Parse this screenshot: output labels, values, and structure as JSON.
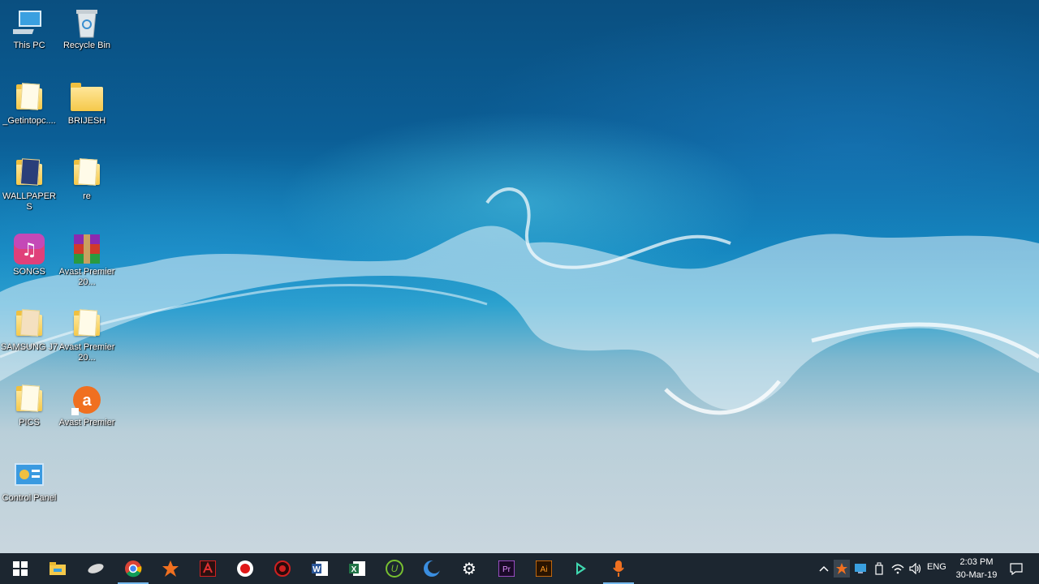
{
  "desktop": {
    "icons": [
      {
        "label": "This PC",
        "icon": "this-pc-icon"
      },
      {
        "label": "Recycle Bin",
        "icon": "recycle-bin-icon"
      },
      {
        "label": "_Getintopc....",
        "icon": "folder-icon"
      },
      {
        "label": "BRIJESH",
        "icon": "folder-icon"
      },
      {
        "label": "WALLPAPERS",
        "icon": "folder-icon"
      },
      {
        "label": "re",
        "icon": "folder-icon"
      },
      {
        "label": "SONGS",
        "icon": "music-icon"
      },
      {
        "label": "Avast Premier 20...",
        "icon": "winrar-archive-icon"
      },
      {
        "label": "SAMSUNG J7",
        "icon": "folder-icon"
      },
      {
        "label": "Avast Premier 20...",
        "icon": "folder-icon"
      },
      {
        "label": "PICS",
        "icon": "folder-icon"
      },
      {
        "label": "Avast Premier",
        "icon": "avast-icon"
      },
      {
        "label": "Control Panel",
        "icon": "control-panel-icon"
      }
    ]
  },
  "taskbar": {
    "apps": [
      "windows-start-icon",
      "file-explorer-icon",
      "pen-app-icon",
      "chrome-icon",
      "avast-icon",
      "acrobat-icon",
      "screen-recorder-icon",
      "game-app-icon",
      "word-icon",
      "excel-icon",
      "utorrent-icon",
      "browser-moon-icon",
      "settings-gear-icon",
      "premiere-icon",
      "illustrator-icon",
      "filmora-icon",
      "microphone-icon"
    ],
    "tray": {
      "language": "ENG",
      "time": "2:03 PM",
      "date": "30-Mar-19"
    }
  },
  "colors": {
    "taskbar": "#1c2630",
    "active_indicator": "#76b9ed"
  }
}
